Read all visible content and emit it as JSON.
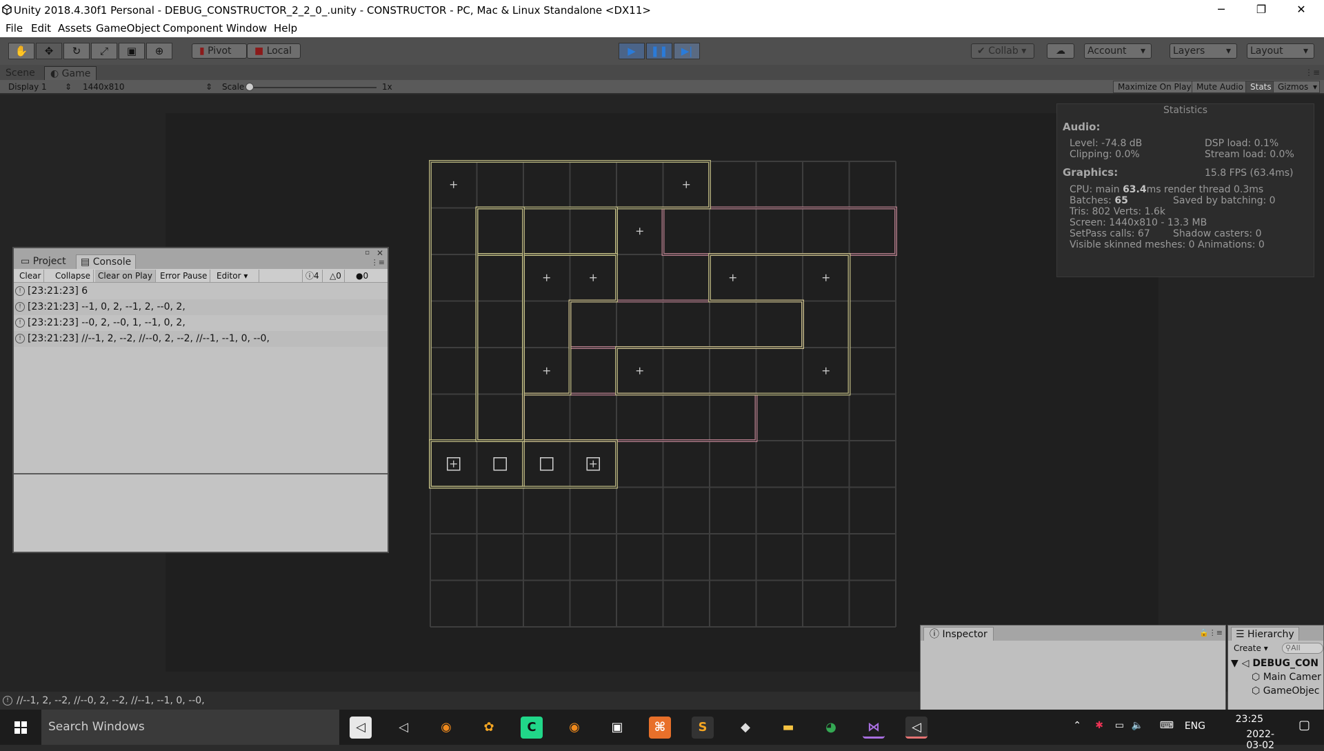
{
  "window": {
    "title": "Unity 2018.4.30f1 Personal - DEBUG_CONSTRUCTOR_2_2_0_.unity - CONSTRUCTOR - PC, Mac & Linux Standalone <DX11>",
    "minimize_glyph": "─",
    "maximize_glyph": "❐",
    "close_glyph": "✕"
  },
  "menu": [
    "File",
    "Edit",
    "Assets",
    "GameObject",
    "Component",
    "Window",
    "Help"
  ],
  "toolbar": {
    "pivot_label": "Pivot",
    "local_label": "Local",
    "collab_label": "Collab",
    "account_label": "Account",
    "layers_label": "Layers",
    "layout_label": "Layout"
  },
  "view_tabs": {
    "scene": "Scene",
    "game": "Game"
  },
  "game_toolbar": {
    "display": "Display 1",
    "resolution": "1440x810",
    "scale_label": "Scale",
    "scale_value": "1x",
    "scale_fraction": 0,
    "maximize": "Maximize On Play",
    "mute": "Mute Audio",
    "stats": "Stats",
    "gizmos": "Gizmos"
  },
  "statistics": {
    "title": "Statistics",
    "audio_heading": "Audio:",
    "level": "Level: -74.8 dB",
    "clipping": "Clipping: 0.0%",
    "dsp": "DSP load: 0.1%",
    "stream": "Stream load: 0.0%",
    "graphics_heading": "Graphics:",
    "fps": "15.8 FPS (63.4ms)",
    "cpu_prefix": "CPU: main ",
    "cpu_main": "63.4",
    "cpu_suffix": "ms  render thread 0.3ms",
    "batches_prefix": "Batches: ",
    "batches": "65",
    "saved_batching": "Saved by batching: 0",
    "tris": "Tris: 802  Verts: 1.6k",
    "screen": "Screen: 1440x810 - 13.3 MB",
    "setpass": "SetPass calls: 67",
    "shadow": "Shadow casters: 0",
    "skinned": "Visible skinned meshes: 0  Animations: 0"
  },
  "console": {
    "tab_project": "Project",
    "tab_console": "Console",
    "clear": "Clear",
    "collapse": "Collapse",
    "clear_on_play": "Clear on Play",
    "error_pause": "Error Pause",
    "editor": "Editor",
    "count_log": "4",
    "count_warn": "0",
    "count_error": "0",
    "logs": [
      "[23:21:23] 6",
      "[23:21:23] --1, 0, 2, --1, 2, --0, 2,",
      "[23:21:23] --0, 2, --0, 1, --1, 0, 2,",
      "[23:21:23] //--1, 2, --2, //--0, 2, --2, //--1, --1, 0, --0,"
    ]
  },
  "status_text": "//--1, 2, --2, //--0, 2, --2, //--1, --1, 0, --0,",
  "inspector": {
    "tab": "Inspector"
  },
  "hierarchy": {
    "tab": "Hierarchy",
    "create": "Create",
    "search_placeholder": "All",
    "root": "DEBUG_CON",
    "items": [
      "Main Camer",
      "GameObjec"
    ]
  },
  "taskbar": {
    "search_placeholder": "Search Windows",
    "lang": "ENG",
    "time": "23:25",
    "date": "2022-03-02"
  },
  "colors": {
    "yellow_outline": "#c9c48a",
    "pink_outline": "#c98a9a",
    "grid": "#3e3e3e"
  }
}
